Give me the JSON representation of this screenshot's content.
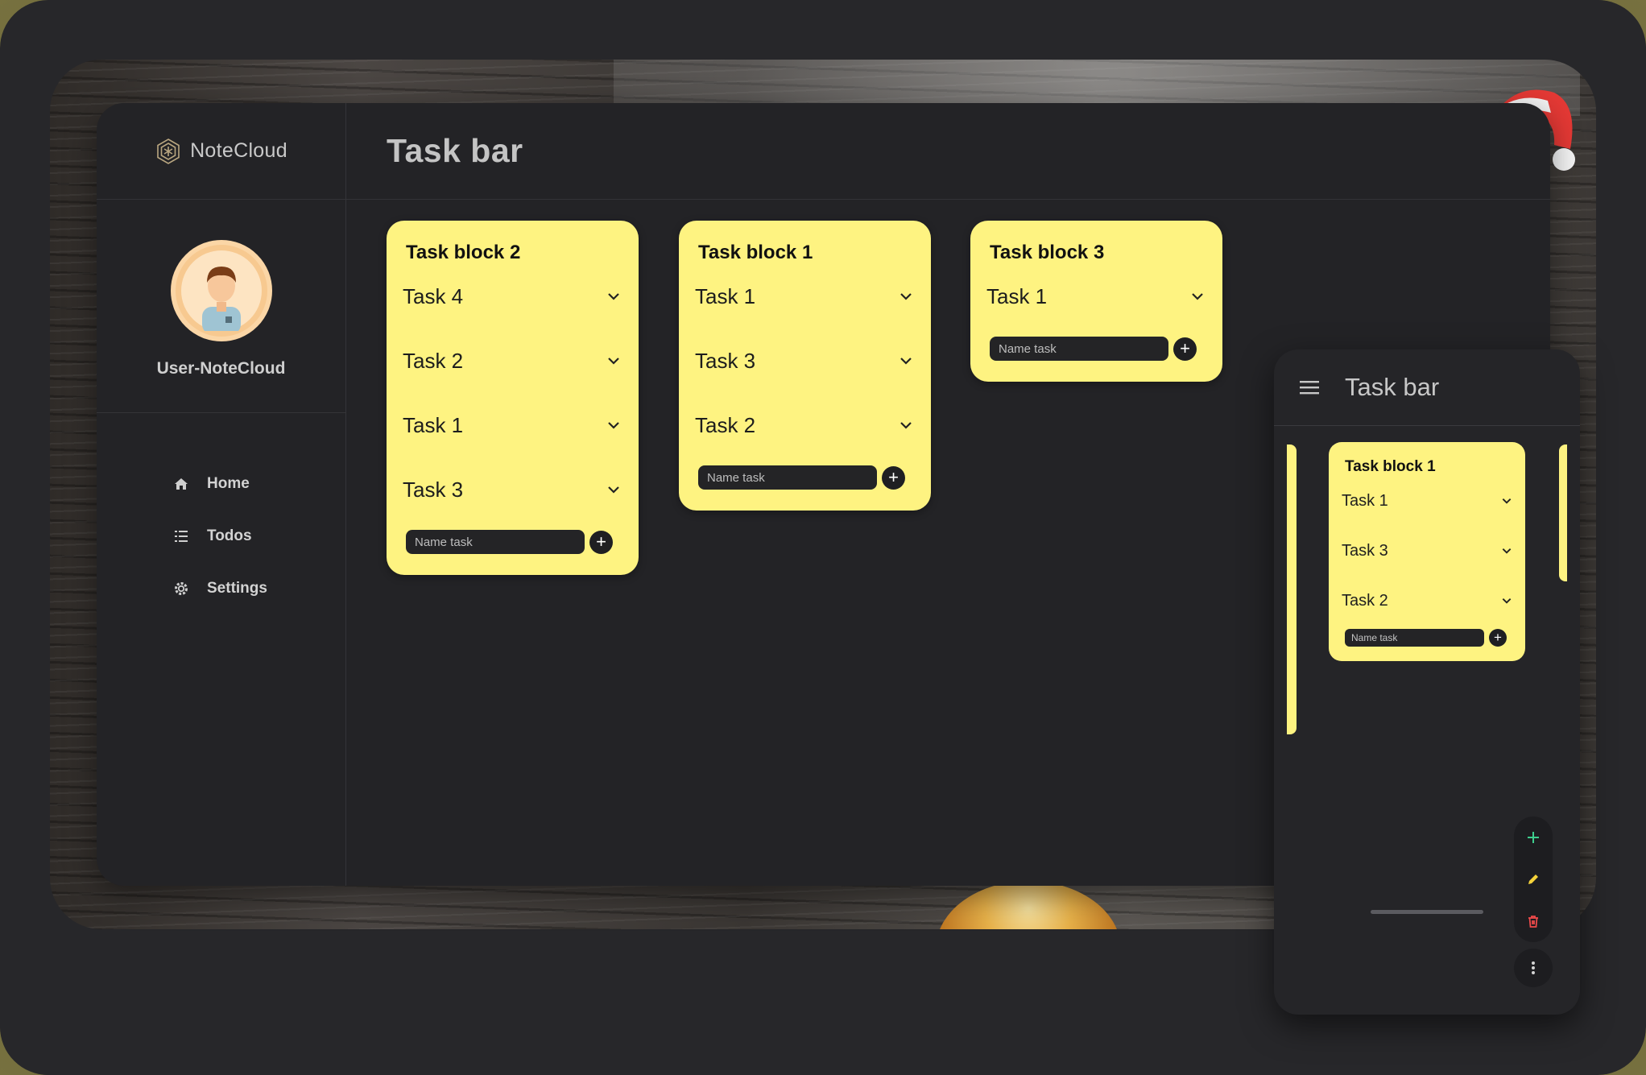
{
  "app": {
    "logo_text": "NoteCloud",
    "page_title": "Task bar"
  },
  "user": {
    "name": "User-NoteCloud"
  },
  "nav": {
    "items": [
      {
        "label": "Home",
        "icon": "home-icon"
      },
      {
        "label": "Todos",
        "icon": "list-icon"
      },
      {
        "label": "Settings",
        "icon": "gear-icon"
      }
    ]
  },
  "blocks": [
    {
      "title": "Task block 2",
      "tasks": [
        "Task 4",
        "Task 2",
        "Task 1",
        "Task 3"
      ],
      "placeholder": "Name task"
    },
    {
      "title": "Task block 1",
      "tasks": [
        "Task 1",
        "Task 3",
        "Task 2"
      ],
      "placeholder": "Name task"
    },
    {
      "title": "Task block 3",
      "tasks": [
        "Task 1"
      ],
      "placeholder": "Name task"
    }
  ],
  "mobile": {
    "page_title": "Task bar",
    "block": {
      "title": "Task block 1",
      "tasks": [
        "Task 1",
        "Task 3",
        "Task 2"
      ],
      "placeholder": "Name task"
    }
  },
  "colors": {
    "card": "#fef381",
    "panel": "#232326",
    "fab_add": "#3ecf8e",
    "fab_edit": "#f5d33a",
    "fab_delete": "#ef4a4a"
  }
}
